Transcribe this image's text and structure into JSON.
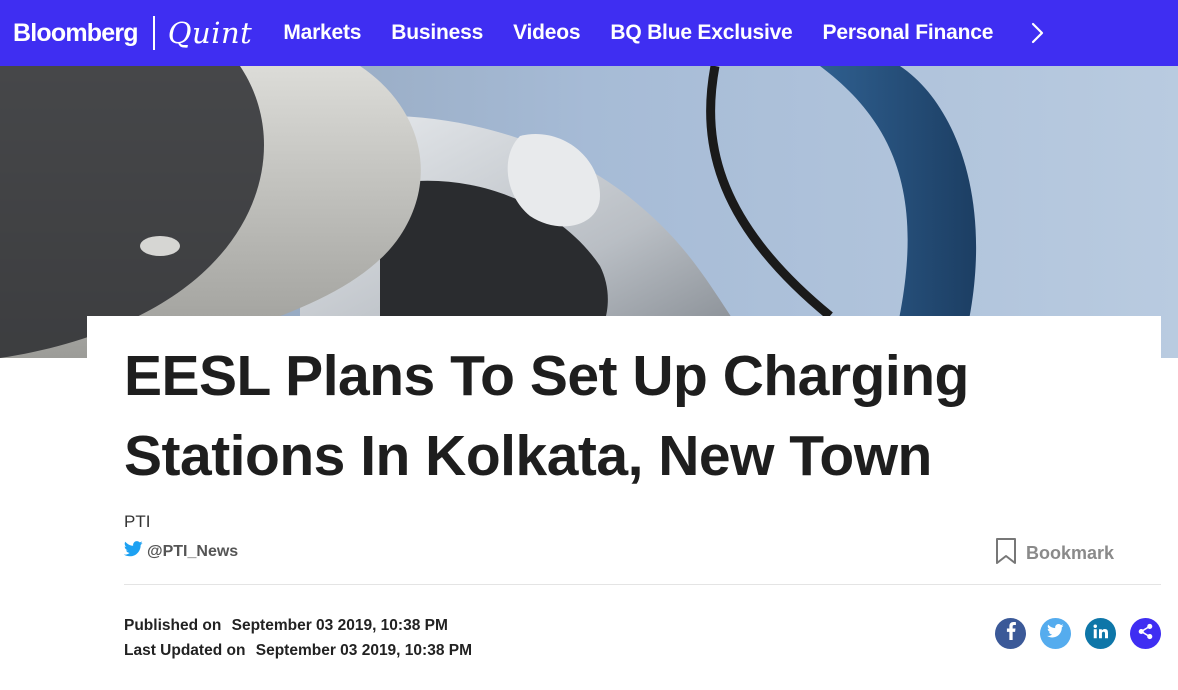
{
  "nav": {
    "logo_primary": "Bloomberg",
    "logo_secondary": "Quint",
    "items": [
      "Markets",
      "Business",
      "Videos",
      "BQ Blue Exclusive",
      "Personal Finance"
    ],
    "next_icon": "chevron-right-icon",
    "bg_color": "#3f2ef2"
  },
  "hero": {
    "icon": "ev-charger-photo"
  },
  "article": {
    "headline_line1": "EESL Plans To Set Up Charging",
    "headline_line2": "Stations In Kolkata, New Town",
    "author": "PTI",
    "twitter_handle": "@PTI_News",
    "bookmark_label": "Bookmark",
    "published_label": "Published on",
    "published_value": "September 03 2019, 10:38 PM",
    "updated_label": "Last Updated on",
    "updated_value": "September 03 2019, 10:38 PM"
  },
  "share": {
    "icons": [
      "facebook-icon",
      "twitter-icon",
      "linkedin-icon",
      "share-icon"
    ],
    "colors": {
      "facebook": "#3b5998",
      "twitter": "#55acee",
      "linkedin": "#0e76a8",
      "share": "#3f2ef2"
    }
  }
}
